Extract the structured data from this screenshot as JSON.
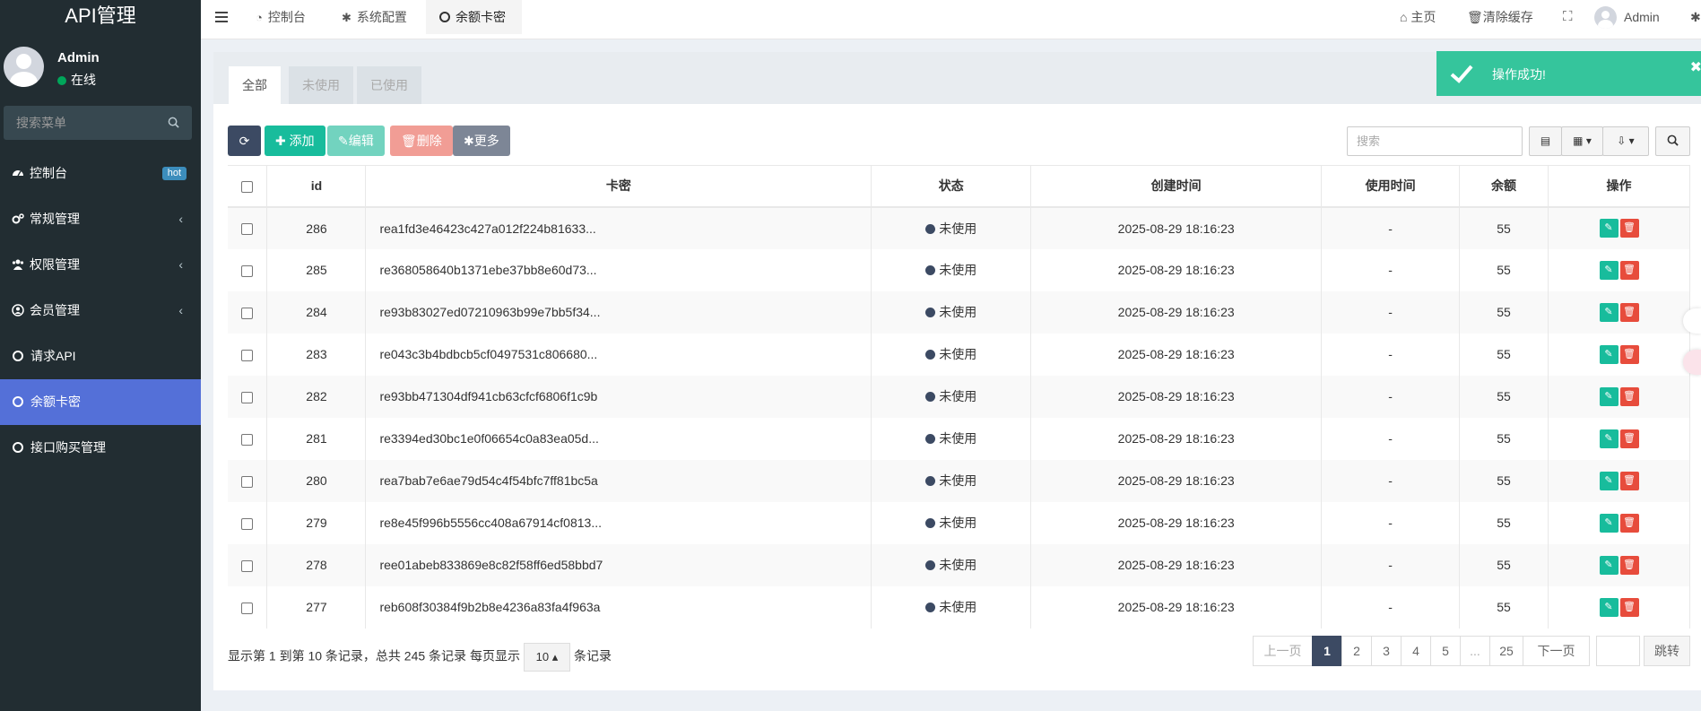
{
  "brand": "API管理",
  "user": {
    "name": "Admin",
    "status": "在线"
  },
  "sidebar": {
    "search_placeholder": "搜索菜单",
    "items": [
      {
        "label": "控制台",
        "icon": "dashboard-icon",
        "badge": "hot"
      },
      {
        "label": "常规管理",
        "icon": "cogs-icon"
      },
      {
        "label": "权限管理",
        "icon": "group-icon"
      },
      {
        "label": "会员管理",
        "icon": "user-circle-icon"
      },
      {
        "label": "请求API",
        "icon": "circle-icon"
      },
      {
        "label": "余额卡密",
        "icon": "circle-icon",
        "active": true
      },
      {
        "label": "接口购买管理",
        "icon": "circle-icon"
      }
    ]
  },
  "header": {
    "tabs": [
      {
        "label": "控制台",
        "icon": "dashboard-icon"
      },
      {
        "label": "系统配置",
        "icon": "gear-icon"
      },
      {
        "label": "余额卡密",
        "icon": "circle-icon",
        "active": true
      }
    ],
    "home": "主页",
    "clear_cache": "清除缓存",
    "admin": "Admin"
  },
  "subtabs": [
    "全部",
    "未使用",
    "已使用"
  ],
  "toolbar": {
    "add": "添加",
    "edit": "编辑",
    "delete": "删除",
    "more": "更多",
    "search_placeholder": "搜索"
  },
  "table": {
    "columns": [
      "id",
      "卡密",
      "状态",
      "创建时间",
      "使用时间",
      "余额",
      "操作"
    ],
    "rows": [
      {
        "id": "286",
        "kami": "rea1fd3e46423c427a012f224b81633...",
        "status": "未使用",
        "created": "2025-08-29 18:16:23",
        "used": "-",
        "balance": "55"
      },
      {
        "id": "285",
        "kami": "re368058640b1371ebe37bb8e60d73...",
        "status": "未使用",
        "created": "2025-08-29 18:16:23",
        "used": "-",
        "balance": "55"
      },
      {
        "id": "284",
        "kami": "re93b83027ed07210963b99e7bb5f34...",
        "status": "未使用",
        "created": "2025-08-29 18:16:23",
        "used": "-",
        "balance": "55"
      },
      {
        "id": "283",
        "kami": "re043c3b4bdbcb5cf0497531c806680...",
        "status": "未使用",
        "created": "2025-08-29 18:16:23",
        "used": "-",
        "balance": "55"
      },
      {
        "id": "282",
        "kami": " re93bb471304df941cb63cfcf6806f1c9b",
        "status": "未使用",
        "created": "2025-08-29 18:16:23",
        "used": "-",
        "balance": "55"
      },
      {
        "id": "281",
        "kami": "re3394ed30bc1e0f06654c0a83ea05d...",
        "status": "未使用",
        "created": "2025-08-29 18:16:23",
        "used": "-",
        "balance": "55"
      },
      {
        "id": "280",
        "kami": " rea7bab7e6ae79d54c4f54bfc7ff81bc5a",
        "status": "未使用",
        "created": "2025-08-29 18:16:23",
        "used": "-",
        "balance": "55"
      },
      {
        "id": "279",
        "kami": "re8e45f996b5556cc408a67914cf0813...",
        "status": "未使用",
        "created": "2025-08-29 18:16:23",
        "used": "-",
        "balance": "55"
      },
      {
        "id": "278",
        "kami": " ree01abeb833869e8c82f58ff6ed58bbd7",
        "status": "未使用",
        "created": "2025-08-29 18:16:23",
        "used": "-",
        "balance": "55"
      },
      {
        "id": "277",
        "kami": " reb608f30384f9b2b8e4236a83fa4f963a",
        "status": "未使用",
        "created": "2025-08-29 18:16:23",
        "used": "-",
        "balance": "55"
      }
    ]
  },
  "footer": {
    "info_prefix": "显示第 1 到第 10 条记录，总共 245 条记录 每页显示",
    "page_size": "10",
    "info_suffix": "条记录",
    "prev": "上一页",
    "pages": [
      "1",
      "2",
      "3",
      "4",
      "5",
      "...",
      "25"
    ],
    "next": "下一页",
    "jump": "跳转"
  },
  "toast": {
    "message": "操作成功!"
  },
  "colors": {
    "sidebar_bg": "#222d32",
    "active_menu": "#5470d8",
    "success": "#18bc9c",
    "danger": "#e74c3c",
    "primary_dark": "#3c4a63"
  }
}
